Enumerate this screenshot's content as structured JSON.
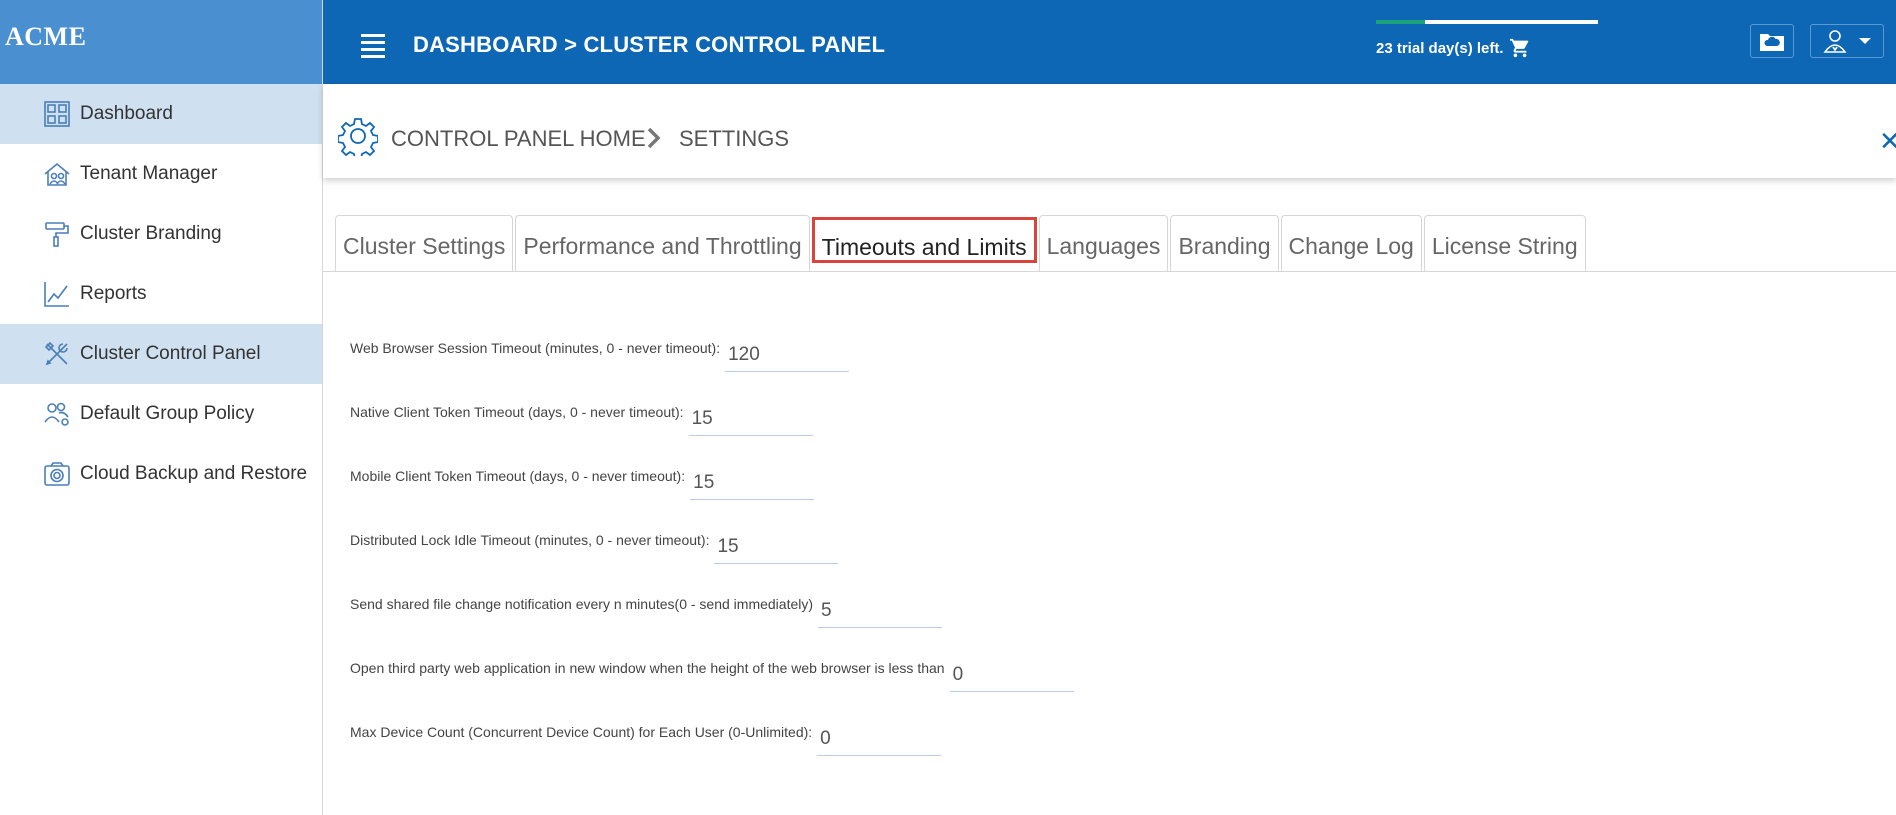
{
  "brand": {
    "name": "ACME"
  },
  "sidebar": {
    "items": [
      {
        "label": "Dashboard",
        "icon": "dashboard-icon",
        "active": true
      },
      {
        "label": "Tenant Manager",
        "icon": "tenant-icon",
        "active": false
      },
      {
        "label": "Cluster Branding",
        "icon": "paint-roller-icon",
        "active": false
      },
      {
        "label": "Reports",
        "icon": "chart-icon",
        "active": false
      },
      {
        "label": "Cluster Control Panel",
        "icon": "tools-icon",
        "active": true
      },
      {
        "label": "Default Group Policy",
        "icon": "users-gear-icon",
        "active": false
      },
      {
        "label": "Cloud Backup and Restore",
        "icon": "camera-icon",
        "active": false
      }
    ]
  },
  "header": {
    "title": "DASHBOARD > CLUSTER CONTROL PANEL",
    "trial_text": "23 trial day(s) left.",
    "trial_progress": 0.22
  },
  "breadcrumb": {
    "home": "CONTROL PANEL HOME",
    "current": "SETTINGS"
  },
  "tabs": [
    {
      "label": "Cluster Settings",
      "active": false
    },
    {
      "label": "Performance and Throttling",
      "active": false
    },
    {
      "label": "Timeouts and Limits",
      "active": true
    },
    {
      "label": "Languages",
      "active": false
    },
    {
      "label": "Branding",
      "active": false
    },
    {
      "label": "Change Log",
      "active": false
    },
    {
      "label": "License String",
      "active": false
    }
  ],
  "form": {
    "fields": [
      {
        "label": "Web Browser Session Timeout (minutes, 0 - never timeout):",
        "value": "120"
      },
      {
        "label": "Native Client Token Timeout (days, 0 - never timeout):",
        "value": "15"
      },
      {
        "label": "Mobile Client Token Timeout (days, 0 - never timeout):",
        "value": "15"
      },
      {
        "label": "Distributed Lock Idle Timeout (minutes, 0 - never timeout):",
        "value": "15"
      },
      {
        "label": "Send shared file change notification every n minutes(0 - send immediately)",
        "value": "5"
      },
      {
        "label": "Open third party web application in new window when the height of the web browser is less than",
        "value": "0"
      },
      {
        "label": "Max Device Count (Concurrent Device Count) for Each User (0-Unlimited):",
        "value": "0"
      }
    ]
  },
  "colors": {
    "topbar": "#0e67b5",
    "brand_bg": "#4a8fd0",
    "active_nav": "#cfe0f1",
    "active_tab_border": "#d9443c"
  }
}
